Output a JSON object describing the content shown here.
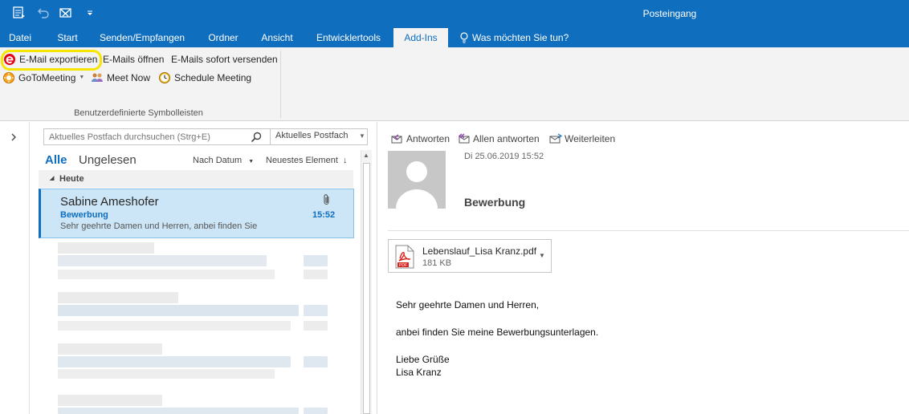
{
  "window": {
    "title": "Posteingang"
  },
  "tabs": [
    {
      "label": "Datei"
    },
    {
      "label": "Start"
    },
    {
      "label": "Senden/Empfangen"
    },
    {
      "label": "Ordner"
    },
    {
      "label": "Ansicht"
    },
    {
      "label": "Entwicklertools"
    },
    {
      "label": "Add-Ins"
    },
    {
      "label": "Was möchten Sie tun?"
    }
  ],
  "ribbon": {
    "export_label": "E-Mail exportieren",
    "open_label": "E-Mails öffnen",
    "send_now_label": "E-Mails sofort versenden",
    "gotomeeting_label": "GoToMeeting",
    "meet_now_label": "Meet Now",
    "schedule_label": "Schedule Meeting",
    "group_label": "Benutzerdefinierte Symbolleisten"
  },
  "search": {
    "placeholder": "Aktuelles Postfach durchsuchen (Strg+E)",
    "scope": "Aktuelles Postfach"
  },
  "filters": {
    "all": "Alle",
    "unread": "Ungelesen",
    "sort_by": "Nach Datum",
    "order": "Neuestes Element"
  },
  "list": {
    "group": "Heute",
    "selected": {
      "sender": "Sabine Ameshofer",
      "subject": "Bewerbung",
      "preview": "Sehr geehrte Damen und Herren,  anbei finden Sie",
      "time": "15:52"
    }
  },
  "reading": {
    "reply": "Antworten",
    "reply_all": "Allen antworten",
    "forward": "Weiterleiten",
    "date": "Di 25.06.2019 15:52",
    "subject": "Bewerbung",
    "attachment": {
      "name": "Lebenslauf_Lisa Kranz.pdf",
      "size": "181 KB",
      "badge": "PDF"
    },
    "body": [
      "Sehr geehrte Damen und Herren,",
      "anbei finden Sie meine Bewerbungsunterlagen.",
      "Liebe Grüße",
      "Lisa Kranz"
    ]
  },
  "colors": {
    "accent": "#106ebe",
    "highlight": "#f6e500",
    "selection": "#cde6f7"
  }
}
